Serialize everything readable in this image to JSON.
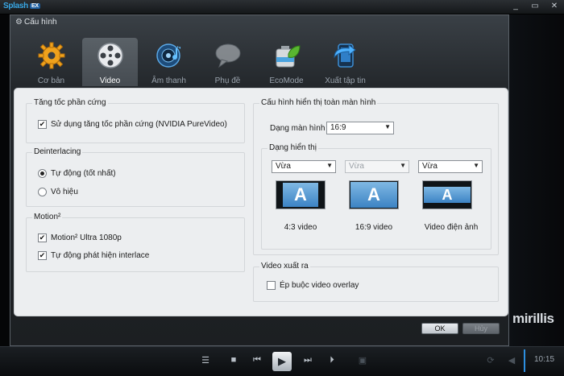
{
  "player": {
    "brand": "Splash",
    "brand_badge": "EX",
    "win_minimize": "_",
    "win_restore": "▭",
    "win_close": "✕",
    "logo_text": "mirillis",
    "time": "10:15"
  },
  "dialog": {
    "title": "Cấu hình",
    "tabs": [
      {
        "label": "Cơ bản",
        "icon": "gear-icon",
        "active": false
      },
      {
        "label": "Video",
        "icon": "film-reel-icon",
        "active": true
      },
      {
        "label": "Âm thanh",
        "icon": "speaker-icon",
        "active": false
      },
      {
        "label": "Phụ đề",
        "icon": "speech-bubble-icon",
        "active": false
      },
      {
        "label": "EcoMode",
        "icon": "battery-leaf-icon",
        "active": false
      },
      {
        "label": "Xuất tập tin",
        "icon": "export-icon",
        "active": false
      }
    ],
    "hw_accel": {
      "title": "Tăng tốc phần cứng",
      "option": "Sử dụng tăng tốc phần cứng (NVIDIA PureVideo)",
      "checked": true
    },
    "deinterlacing": {
      "title": "Deinterlacing",
      "options": [
        "Tự động (tốt nhất)",
        "Vô hiệu"
      ],
      "selected": "Tự động (tốt nhất)"
    },
    "motion": {
      "title": "Motion²",
      "options": [
        {
          "label": "Motion²  Ultra 1080p",
          "checked": true
        },
        {
          "label": "Tự động phát hiện interlace",
          "checked": true
        }
      ]
    },
    "fullscreen": {
      "title": "Cấu hình hiển thị toàn màn hình",
      "screen_type_label": "Dạng màn hình",
      "screen_type_value": "16:9",
      "display_type_label": "Dạng hiển thị",
      "columns": [
        {
          "select": "Vừa",
          "disabled": false,
          "caption": "4:3 video"
        },
        {
          "select": "Vừa",
          "disabled": true,
          "caption": "16:9 video"
        },
        {
          "select": "Vừa",
          "disabled": false,
          "caption": "Video điện ảnh"
        }
      ],
      "thumb_letter": "A"
    },
    "video_output": {
      "title": "Video xuất ra",
      "option": "Ép buộc video overlay",
      "checked": false
    },
    "ok_label": "OK",
    "cancel_label": "Hủy"
  },
  "colors": {
    "accent": "#2d8fe0",
    "panel": "#eceef0",
    "dialog_bg": "#23272b"
  }
}
